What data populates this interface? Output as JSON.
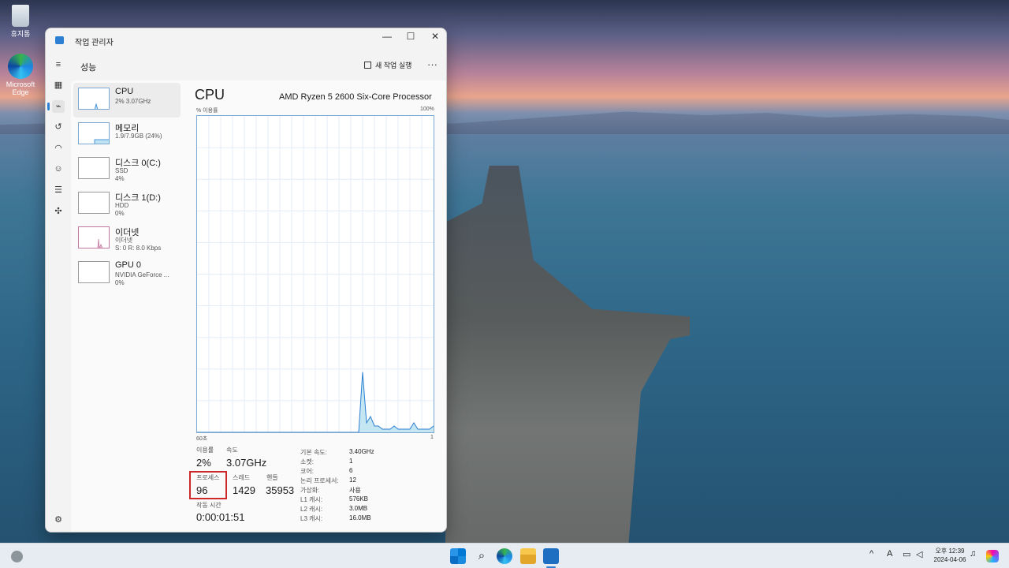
{
  "desktop": {
    "icons": [
      {
        "label": "휴지통"
      },
      {
        "label": "Microsoft Edge"
      }
    ]
  },
  "window": {
    "title": "작업 관리자",
    "page_title": "성능",
    "run_new_task": "새 작업 실행",
    "more": "···",
    "caption": {
      "minimize": "—",
      "maximize": "☐",
      "close": "✕"
    }
  },
  "nav": {
    "icons": [
      "menu-icon",
      "processes-icon",
      "performance-icon",
      "app-history-icon",
      "startup-icon",
      "users-icon",
      "details-icon",
      "services-icon",
      "settings-icon"
    ]
  },
  "perf_list": [
    {
      "name": "CPU",
      "sub": "2% 3.07GHz",
      "usage": 0.02
    },
    {
      "name": "메모리",
      "sub": "1.9/7.9GB (24%)",
      "usage": 0.24
    },
    {
      "name": "디스크 0(C:)",
      "sub": "SSD",
      "sub2": "4%",
      "usage": 0.04
    },
    {
      "name": "디스크 1(D:)",
      "sub": "HDD",
      "sub2": "0%",
      "usage": 0
    },
    {
      "name": "이더넷",
      "sub": "이더넷",
      "sub2": "S: 0 R: 8.0 Kbps",
      "usage": 0
    },
    {
      "name": "GPU 0",
      "sub": "NVIDIA GeForce ...",
      "sub2": "0%",
      "usage": 0
    }
  ],
  "cpu": {
    "title": "CPU",
    "model": "AMD Ryzen 5 2600 Six-Core Processor",
    "axis_top_left": "% 이용률",
    "axis_top_right": "100%",
    "axis_bottom_left": "60초",
    "axis_bottom_right": "1",
    "stats": {
      "utilization_label": "이용률",
      "utilization": "2%",
      "speed_label": "속도",
      "speed": "3.07GHz",
      "processes_label": "프로세스",
      "processes": "96",
      "threads_label": "스레드",
      "threads": "1429",
      "handles_label": "핸들",
      "handles": "35953",
      "uptime_label": "작동 시간",
      "uptime": "0:00:01:51"
    },
    "specs": [
      {
        "key": "기본 속도:",
        "value": "3.40GHz"
      },
      {
        "key": "소켓:",
        "value": "1"
      },
      {
        "key": "코어:",
        "value": "6"
      },
      {
        "key": "논리 프로세서:",
        "value": "12"
      },
      {
        "key": "가상화:",
        "value": "사용"
      },
      {
        "key": "L1 캐시:",
        "value": "576KB"
      },
      {
        "key": "L2 캐시:",
        "value": "3.0MB"
      },
      {
        "key": "L3 캐시:",
        "value": "16.0MB"
      }
    ],
    "history": [
      0,
      0,
      0,
      0,
      0,
      0,
      0,
      0,
      0,
      0,
      0,
      0,
      0,
      0,
      0,
      0,
      0,
      0,
      0,
      0,
      0,
      0,
      0,
      0,
      0,
      0,
      0,
      0,
      0,
      0,
      0,
      0,
      0,
      0,
      0,
      0,
      0,
      0,
      0,
      0,
      0,
      0,
      19,
      3,
      5,
      2,
      2,
      1,
      1,
      1,
      2,
      1,
      1,
      1,
      1,
      3,
      1,
      1,
      1,
      1,
      2
    ]
  },
  "taskbar": {
    "tray": {
      "chevron": "^",
      "ime": "A"
    },
    "time": "오후 12:39",
    "date": "2024-04-06"
  },
  "colors": {
    "accent": "#2c7fd2",
    "graph_border": "#7aa7cf",
    "highlight": "#cc2a2a"
  }
}
